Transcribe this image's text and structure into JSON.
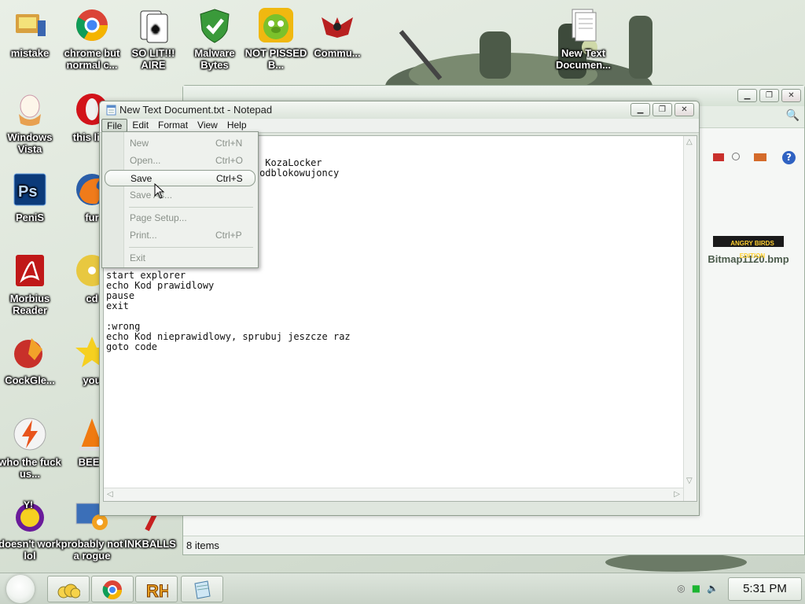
{
  "desktop": {
    "icons": [
      {
        "label": "mistake",
        "icon": "computer-icon"
      },
      {
        "label": "chrome but normal c...",
        "icon": "chrome-icon"
      },
      {
        "label": "SO LIT!!! AIRE",
        "icon": "solitaire-icon"
      },
      {
        "label": "Malware Bytes",
        "icon": "shield-icon"
      },
      {
        "label": "NOT PISSED B...",
        "icon": "angry-birds-pig-icon"
      },
      {
        "label": "Commu...",
        "icon": "eagle-emblem-icon"
      },
      {
        "label": "New Text Documen...",
        "icon": "text-document-icon"
      },
      {
        "label": "Windows Vista",
        "icon": "egg-icon"
      },
      {
        "label": "this like",
        "icon": "opera-icon"
      },
      {
        "label": "PeniS",
        "icon": "photoshop-icon"
      },
      {
        "label": "fur",
        "icon": "firefox-icon"
      },
      {
        "label": "Morbius Reader",
        "icon": "pdf-icon"
      },
      {
        "label": "cd",
        "icon": "cd-icon"
      },
      {
        "label": "CockGle...",
        "icon": "ccleaner-icon"
      },
      {
        "label": "you",
        "icon": "star-icon"
      },
      {
        "label": "who the fuck us...",
        "icon": "lightning-icon"
      },
      {
        "label": "BEEF",
        "icon": "vlc-cone-icon"
      },
      {
        "label": "doesn't work lol",
        "icon": "yahoo-messenger-icon"
      },
      {
        "label": "probably not a rogue",
        "icon": "monitor-gear-icon"
      },
      {
        "label": "INKBALLS",
        "icon": "inkball-icon"
      }
    ]
  },
  "explorer": {
    "status": "8 items",
    "file_label": "Bitmap1120.bmp",
    "file_thumb_text": "ANGRY BIRDS EDITION"
  },
  "notepad": {
    "title": "New Text Document.txt - Notepad",
    "menus": [
      "File",
      "Edit",
      "Format",
      "View",
      "Help"
    ],
    "content": "          exe\n\n          zablokowany przez KozaLocker\n          musisz kupic kod odblokowujoncy\n\n\n\n\n          o correct\n          goto wrong\n\n\n\nstart explorer\necho Kod prawidlowy\npause\nexit\n\n:wrong\necho Kod nieprawidlowy, sprubuj jeszcze raz\ngoto code",
    "file_menu": [
      {
        "label": "New",
        "shortcut": "Ctrl+N"
      },
      {
        "label": "Open...",
        "shortcut": "Ctrl+O"
      },
      {
        "label": "Save",
        "shortcut": "Ctrl+S"
      },
      {
        "label": "Save As...",
        "shortcut": ""
      },
      {
        "label": "Page Setup...",
        "shortcut": ""
      },
      {
        "label": "Print...",
        "shortcut": "Ctrl+P"
      },
      {
        "label": "Exit",
        "shortcut": ""
      }
    ]
  },
  "taskbar": {
    "clock": "5:31 PM",
    "buttons": [
      "explorer-icon",
      "chrome-icon",
      "rh-icon",
      "notepad-icon"
    ]
  },
  "colors": {
    "desktop_bg": "#dfe7dc",
    "menu_bg": "#eef1ed",
    "menu_disabled": "#8a918a",
    "taskbar_bg": "#c9d3c8"
  }
}
